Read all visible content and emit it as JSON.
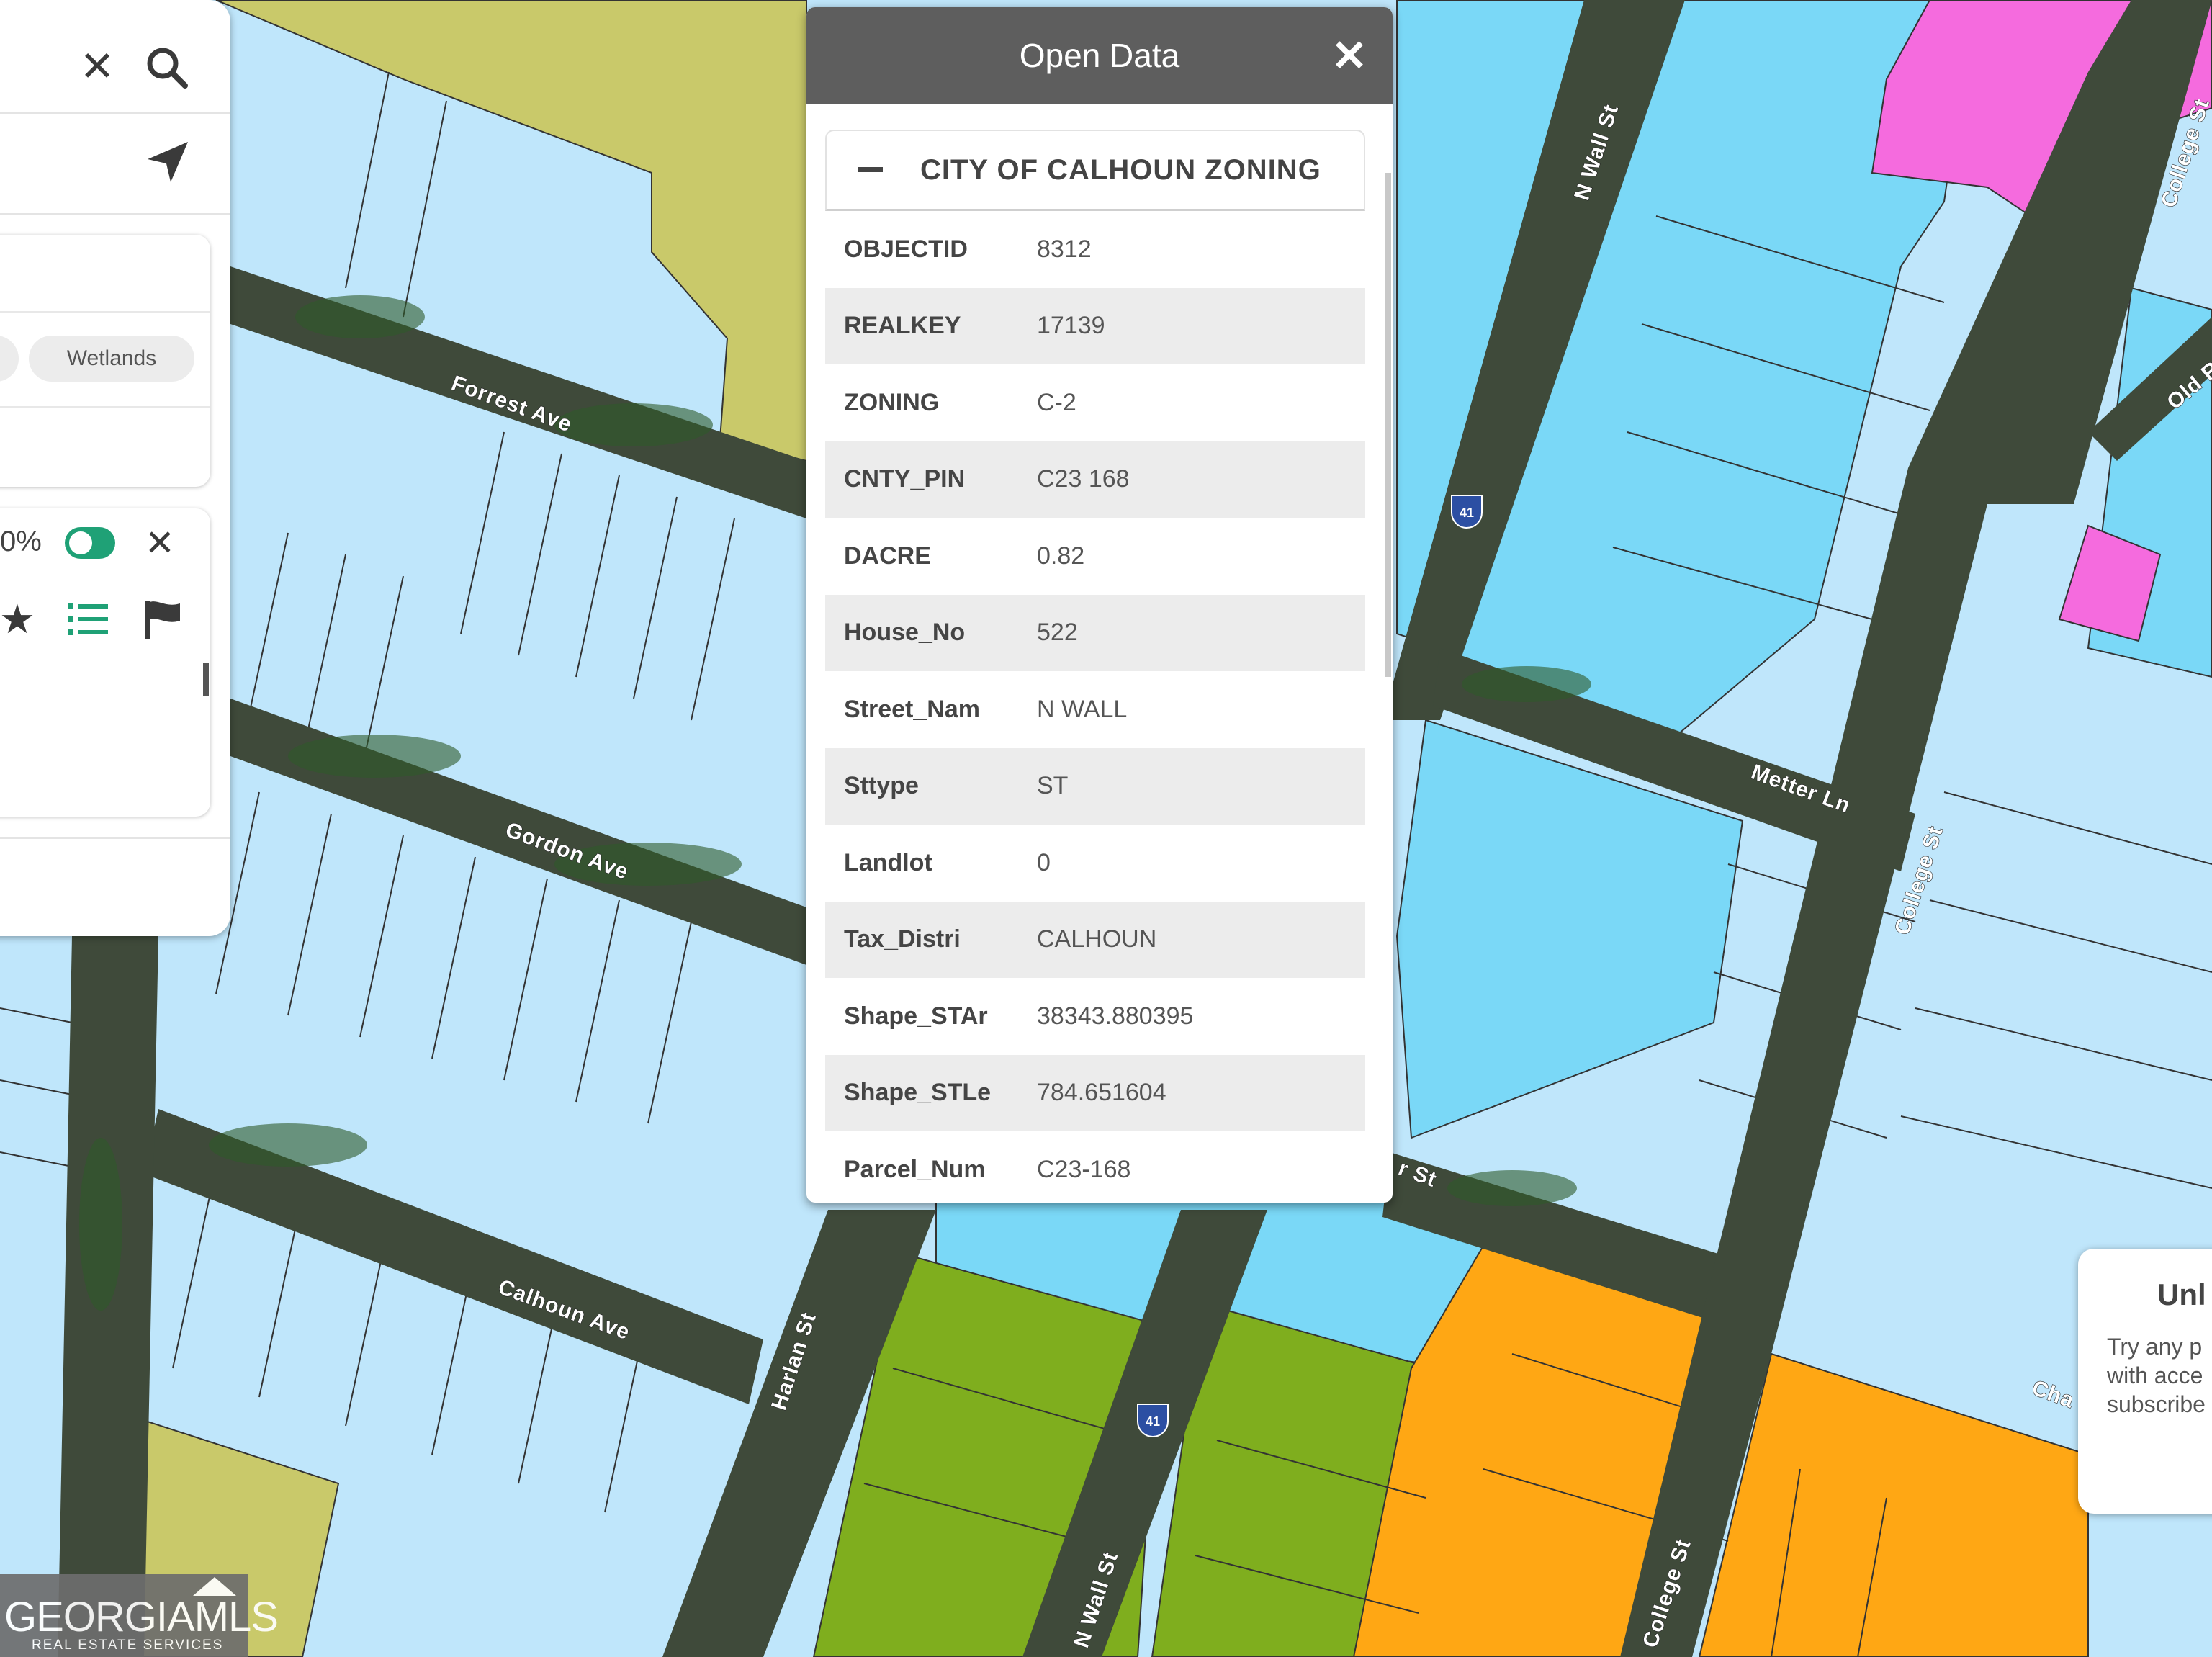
{
  "popup": {
    "title": "Open Data",
    "section_title": "CITY OF CALHOUN ZONING",
    "attributes": [
      {
        "key": "OBJECTID",
        "value": "8312"
      },
      {
        "key": "REALKEY",
        "value": "17139"
      },
      {
        "key": "ZONING",
        "value": "C-2"
      },
      {
        "key": "CNTY_PIN",
        "value": "C23 168"
      },
      {
        "key": "DACRE",
        "value": "0.82"
      },
      {
        "key": "House_No",
        "value": "522"
      },
      {
        "key": "Street_Nam",
        "value": "N WALL"
      },
      {
        "key": "Sttype",
        "value": "ST"
      },
      {
        "key": "Landlot",
        "value": "0"
      },
      {
        "key": "Tax_Distri",
        "value": "CALHOUN"
      },
      {
        "key": "Shape_STAr",
        "value": "38343.880395"
      },
      {
        "key": "Shape_STLe",
        "value": "784.651604"
      },
      {
        "key": "Parcel_Num",
        "value": "C23-168"
      }
    ]
  },
  "left_panel": {
    "chip_label": "Wetlands",
    "opacity_text": "0%"
  },
  "map": {
    "streets": {
      "forrest": "Forrest Ave",
      "gordon": "Gordon Ave",
      "calhoun": "Calhoun Ave",
      "harlan": "Harlan St",
      "n_wall_top": "N Wall St",
      "n_wall_bottom": "N Wall St",
      "metter": "Metter Ln",
      "college_mid": "College St",
      "college_top": "College St",
      "college_bottom": "College St",
      "old_r": "Old R",
      "r_st": "r St",
      "cha": "Cha"
    },
    "route_shield": "41",
    "zone_colors": {
      "residential": "#bfe6fb",
      "commercial": "#7ad8f7",
      "agricultural": "#c9c96a",
      "green": "#7fae1e",
      "orange": "#ffa714",
      "pink": "#f56bde"
    }
  },
  "promo": {
    "title": "Unl",
    "text": "Try any p\nwith acce\nsubscribe"
  },
  "logo": {
    "brand": "GEORGIAMLS",
    "tagline": "REAL ESTATE SERVICES"
  }
}
